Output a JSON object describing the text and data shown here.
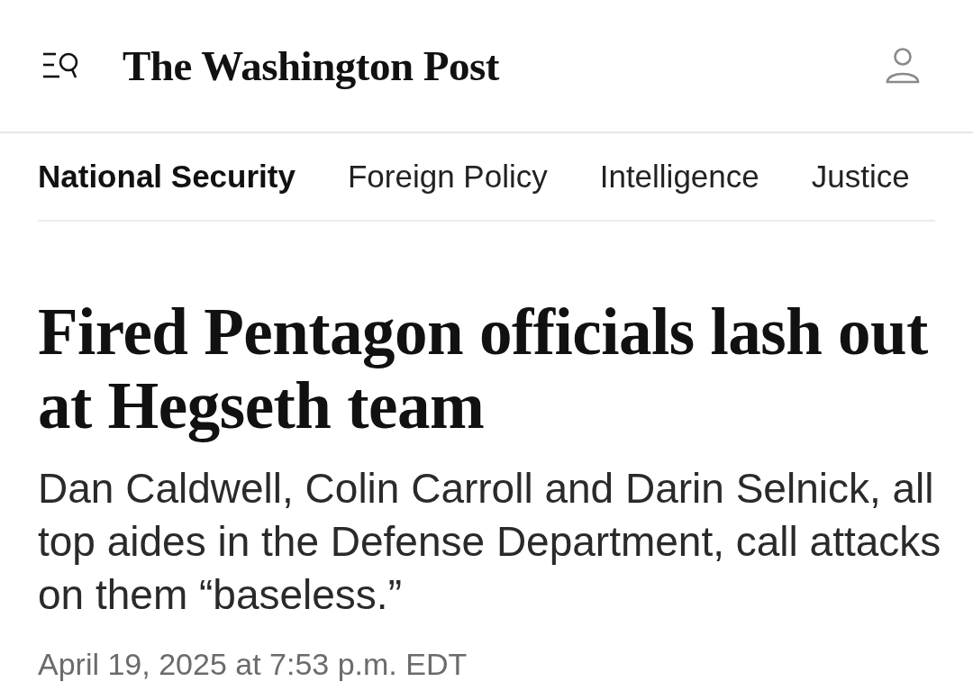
{
  "header": {
    "logo": "The Washington Post"
  },
  "nav": {
    "items": [
      {
        "label": "National Security",
        "selected": true
      },
      {
        "label": "Foreign Policy",
        "selected": false
      },
      {
        "label": "Intelligence",
        "selected": false
      },
      {
        "label": "Justice",
        "selected": false
      }
    ]
  },
  "article": {
    "headline": "Fired Pentagon officials lash out at Hegseth team",
    "dek": "Dan Caldwell, Colin Carroll and Darin Selnick, all top aides in the Defense Department, call attacks on them “baseless.”",
    "timestamp": "April 19, 2025 at 7:53 p.m. EDT"
  }
}
